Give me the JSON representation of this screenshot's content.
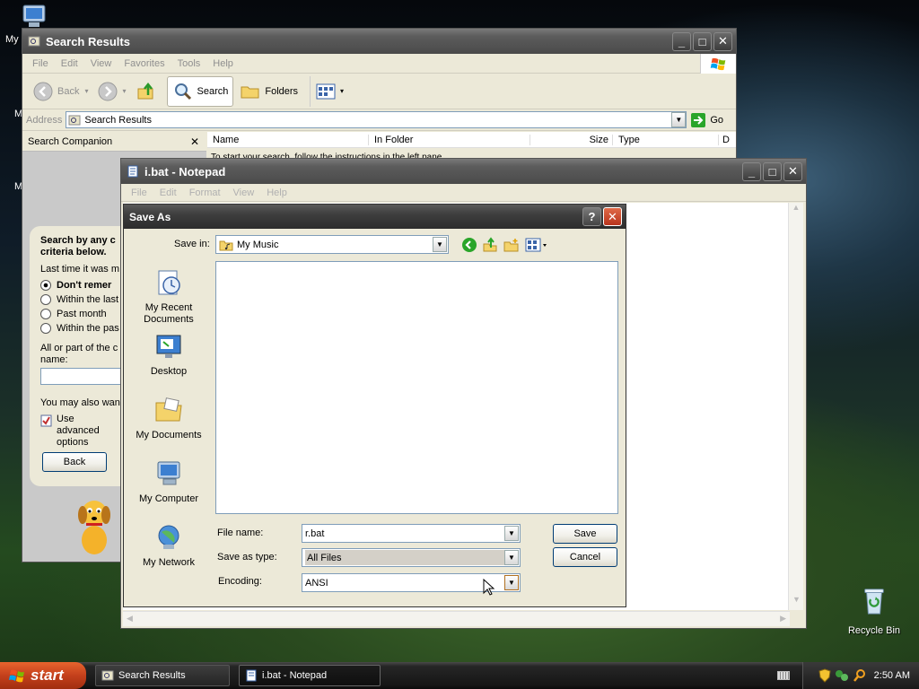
{
  "desktop": {
    "recycle_bin_label": "Recycle Bin",
    "partial_labels": [
      "My",
      "M",
      "M"
    ]
  },
  "search_window": {
    "title": "Search Results",
    "menu": [
      "File",
      "Edit",
      "View",
      "Favorites",
      "Tools",
      "Help"
    ],
    "toolbar": {
      "back": "Back",
      "search": "Search",
      "folders": "Folders"
    },
    "address": {
      "label": "Address",
      "value": "Search Results",
      "go": "Go"
    },
    "companion": {
      "title": "Search Companion",
      "heading": "Search by any or all of the criteria below.",
      "heading_visible": "Search by any c criteria below.",
      "last_time": "Last time it was m",
      "options": [
        "Don't remer",
        "Within the last",
        "Past month",
        "Within the pas"
      ],
      "name_label": "All or part of the c name:",
      "also_want": "You may also wan",
      "advanced": "Use advanced options",
      "back_button": "Back"
    },
    "columns": [
      "Name",
      "In Folder",
      "Size",
      "Type",
      "D"
    ],
    "empty_text": "To start your search, follow the instructions in the left pane."
  },
  "notepad_window": {
    "title": "i.bat - Notepad",
    "menu": [
      "File",
      "Edit",
      "Format",
      "View",
      "Help"
    ]
  },
  "save_dialog": {
    "title": "Save As",
    "help_button": "?",
    "save_in_label": "Save in:",
    "save_in_value": "My Music",
    "places": [
      {
        "label": "My Recent Documents",
        "icon": "recent-documents-icon"
      },
      {
        "label": "Desktop",
        "icon": "desktop-icon"
      },
      {
        "label": "My Documents",
        "icon": "my-documents-icon"
      },
      {
        "label": "My Computer",
        "icon": "my-computer-icon"
      },
      {
        "label": "My Network",
        "icon": "my-network-icon"
      }
    ],
    "file_name_label": "File name:",
    "file_name_value": "r.bat",
    "save_as_type_label": "Save as type:",
    "save_as_type_value": "All Files",
    "encoding_label": "Encoding:",
    "encoding_value": "ANSI",
    "save_button": "Save",
    "cancel_button": "Cancel"
  },
  "taskbar": {
    "start": "start",
    "tasks": [
      "Search Results",
      "i.bat - Notepad"
    ],
    "clock": "2:50 AM"
  },
  "colors": {
    "xp_logo": [
      "#f25022",
      "#7fba00",
      "#00a4ef",
      "#ffb900"
    ],
    "close_button": "#c8411f",
    "back_nav_icon": "#2aa52a"
  }
}
